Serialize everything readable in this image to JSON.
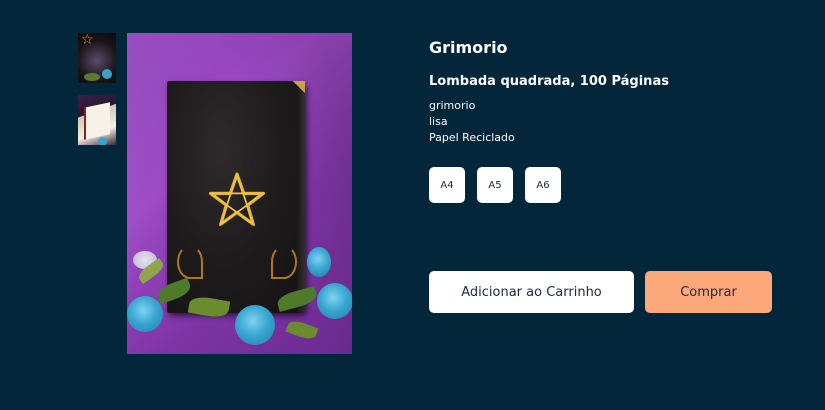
{
  "product": {
    "title": "Grimorio",
    "subtitle": "Lombada quadrada, 100 Páginas",
    "details": [
      "grimorio",
      "lisa",
      "Papel Reciclado"
    ]
  },
  "gallery": {
    "thumbnails": [
      {
        "icon": "book-cover-thumbnail"
      },
      {
        "icon": "book-open-thumbnail"
      }
    ]
  },
  "sizes": [
    "A4",
    "A5",
    "A6"
  ],
  "actions": {
    "add_to_cart": "Adicionar ao Carrinho",
    "buy": "Comprar"
  },
  "colors": {
    "background": "#03263a",
    "buy_button": "#fca87a",
    "cart_button": "#ffffff"
  }
}
